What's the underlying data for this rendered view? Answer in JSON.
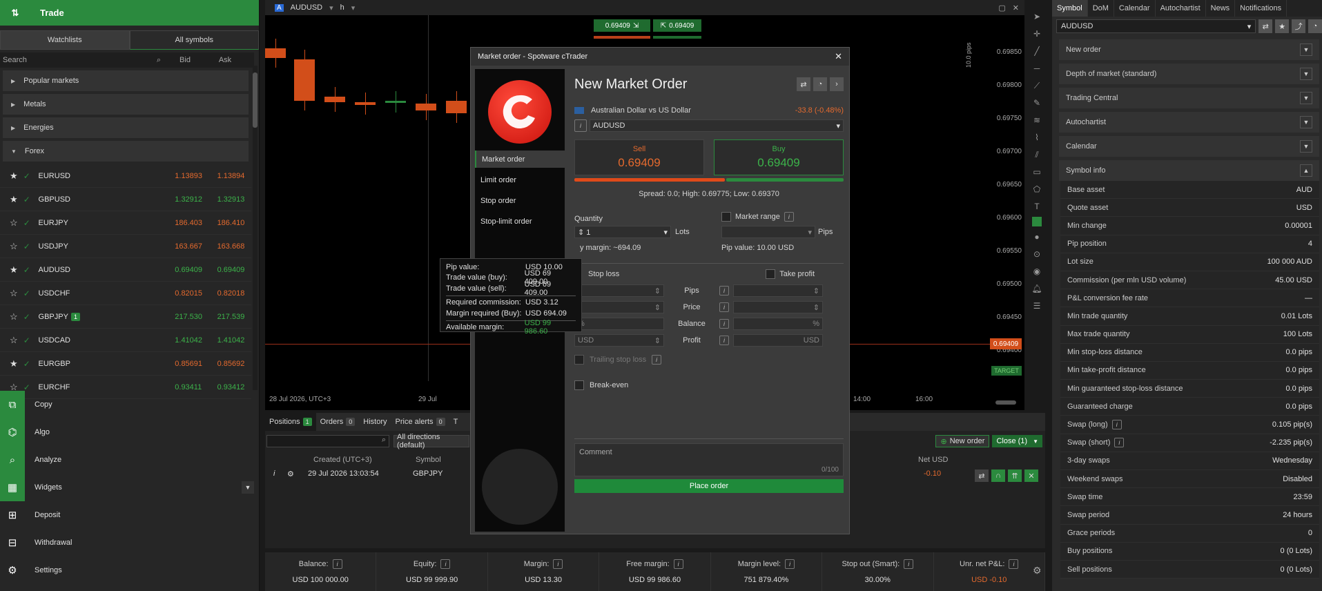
{
  "left": {
    "title": "Trade",
    "tabs": [
      "Watchlists",
      "All symbols"
    ],
    "search_placeholder": "Search",
    "bid_label": "Bid",
    "ask_label": "Ask",
    "groups": [
      "Popular markets",
      "Metals",
      "Energies",
      "Forex"
    ],
    "symbols": [
      {
        "star": "★",
        "name": "EURUSD",
        "bid": "1.13893",
        "ask": "1.13894",
        "color": "#e56a2e"
      },
      {
        "star": "★",
        "name": "GBPUSD",
        "bid": "1.32912",
        "ask": "1.32913",
        "color": "#3cb34a"
      },
      {
        "star": "☆",
        "name": "EURJPY",
        "bid": "186.403",
        "ask": "186.410",
        "color": "#e56a2e"
      },
      {
        "star": "☆",
        "name": "USDJPY",
        "bid": "163.667",
        "ask": "163.668",
        "color": "#e56a2e"
      },
      {
        "star": "★",
        "name": "AUDUSD",
        "bid": "0.69409",
        "ask": "0.69409",
        "color": "#3cb34a"
      },
      {
        "star": "☆",
        "name": "USDCHF",
        "bid": "0.82015",
        "ask": "0.82018",
        "color": "#e56a2e"
      },
      {
        "star": "☆",
        "name": "GBPJPY",
        "badge": "1",
        "bid": "217.530",
        "ask": "217.539",
        "color": "#3cb34a"
      },
      {
        "star": "☆",
        "name": "USDCAD",
        "bid": "1.41042",
        "ask": "1.41042",
        "color": "#3cb34a"
      },
      {
        "star": "★",
        "name": "EURGBP",
        "bid": "0.85691",
        "ask": "0.85692",
        "color": "#e56a2e"
      },
      {
        "star": "☆",
        "name": "EURCHF",
        "bid": "0.93411",
        "ask": "0.93412",
        "color": "#3cb34a"
      }
    ],
    "nav": [
      "Copy",
      "Algo",
      "Analyze",
      "Widgets",
      "Deposit",
      "Withdrawal",
      "Settings"
    ]
  },
  "chart": {
    "symbol": "AUDUSD",
    "timeframe": "h",
    "sell_box": "0.69409",
    "buy_box": "0.69409",
    "prices": [
      "0.69850",
      "0.69800",
      "0.69750",
      "0.69700",
      "0.69650",
      "0.69600",
      "0.69550",
      "0.69500",
      "0.69450",
      "0.69400"
    ],
    "current_price": "0.69409",
    "pips_label": "10.0 pips",
    "times": [
      "28 Jul 2026, UTC+3",
      "29 Jul",
      "14:00",
      "16:00"
    ],
    "target_label": "TARGET"
  },
  "bottom": {
    "tabs": [
      {
        "label": "Positions",
        "badge": "1"
      },
      {
        "label": "Orders",
        "badge": "0"
      },
      {
        "label": "History"
      },
      {
        "label": "Price alerts",
        "badge": "0"
      },
      {
        "label": "T"
      }
    ],
    "filter": "All directions (default)",
    "new_order": "New order",
    "close": "Close (1)",
    "headers": [
      "Created (UTC+3)",
      "Symbol",
      "Net USD"
    ],
    "row": {
      "created": "29 Jul 2026 13:03:54",
      "symbol": "GBPJPY",
      "net": "-0.10"
    }
  },
  "status": [
    {
      "label": "Balance:",
      "value": "USD 100 000.00"
    },
    {
      "label": "Equity:",
      "value": "USD 99 999.90"
    },
    {
      "label": "Margin:",
      "value": "USD 13.30"
    },
    {
      "label": "Free margin:",
      "value": "USD 99 986.60"
    },
    {
      "label": "Margin level:",
      "value": "751 879.40%"
    },
    {
      "label": "Stop out (Smart):",
      "value": "30.00%"
    },
    {
      "label": "Unr. net P&L:",
      "value": "USD -0.10"
    }
  ],
  "right": {
    "tabs": [
      "Symbol",
      "DoM",
      "Calendar",
      "Autochartist",
      "News",
      "Notifications"
    ],
    "symbol": "AUDUSD",
    "sections": [
      "New order",
      "Depth of market (standard)",
      "Trading Central",
      "Autochartist",
      "Calendar",
      "Symbol info"
    ],
    "info": [
      {
        "k": "Base asset",
        "v": "AUD"
      },
      {
        "k": "Quote asset",
        "v": "USD"
      },
      {
        "k": "Min change",
        "v": "0.00001"
      },
      {
        "k": "Pip position",
        "v": "4"
      },
      {
        "k": "Lot size",
        "v": "100 000 AUD"
      },
      {
        "k": "Commission (per mln USD volume)",
        "v": "45.00 USD"
      },
      {
        "k": "P&L conversion fee rate",
        "v": "—"
      },
      {
        "k": "Min trade quantity",
        "v": "0.01 Lots"
      },
      {
        "k": "Max trade quantity",
        "v": "100 Lots"
      },
      {
        "k": "Min stop-loss distance",
        "v": "0.0 pips"
      },
      {
        "k": "Min take-profit distance",
        "v": "0.0 pips"
      },
      {
        "k": "Min guaranteed stop-loss distance",
        "v": "0.0 pips"
      },
      {
        "k": "Guaranteed charge",
        "v": "0.0 pips"
      },
      {
        "k": "Swap (long)",
        "v": "0.105 pip(s)",
        "i": true
      },
      {
        "k": "Swap (short)",
        "v": "-2.235 pip(s)",
        "i": true
      },
      {
        "k": "3-day swaps",
        "v": "Wednesday"
      },
      {
        "k": "Weekend swaps",
        "v": "Disabled"
      },
      {
        "k": "Swap time",
        "v": "23:59"
      },
      {
        "k": "Swap period",
        "v": "24 hours"
      },
      {
        "k": "Grace periods",
        "v": "0"
      },
      {
        "k": "Buy positions",
        "v": "0 (0 Lots)"
      },
      {
        "k": "Sell positions",
        "v": "0 (0 Lots)"
      }
    ]
  },
  "modal": {
    "title": "Market order - Spotware cTrader",
    "heading": "New Market Order",
    "menu": [
      "Market order",
      "Limit order",
      "Stop order",
      "Stop-limit order"
    ],
    "symbol_full": "Australian Dollar vs US Dollar",
    "change": "-33.8 (-0.48%)",
    "symbol": "AUDUSD",
    "sell_label": "Sell",
    "sell_price": "0.69409",
    "buy_label": "Buy",
    "buy_price": "0.69409",
    "spread": "Spread: 0.0; High: 0.69775; Low: 0.69370",
    "quantity_label": "Quantity",
    "quantity": "1",
    "lots": "Lots",
    "market_range": "Market range",
    "pips": "Pips",
    "margin": "y margin: ~694.09",
    "pip_value": "Pip value: 10.00 USD",
    "stop_loss": "Stop loss",
    "take_profit": "Take profit",
    "mid_labels": [
      "Pips",
      "Price",
      "Balance",
      "Profit"
    ],
    "pct": "%",
    "usd": "USD",
    "trailing": "Trailing stop loss",
    "break_even": "Break-even",
    "comment": "Comment",
    "comment_count": "0/100",
    "place_order": "Place order"
  },
  "tooltip": {
    "rows1": [
      {
        "k": "Pip value:",
        "v": "USD 10.00"
      },
      {
        "k": "Trade value (buy):",
        "v": "USD 69 409.00"
      },
      {
        "k": "Trade value (sell):",
        "v": "USD 69 409.00"
      }
    ],
    "rows2": [
      {
        "k": "Required commission:",
        "v": "USD 3.12"
      },
      {
        "k": "Margin required (Buy):",
        "v": "USD 694.09"
      }
    ],
    "avail": {
      "k": "Available margin:",
      "v": "USD 99 986.60"
    }
  }
}
